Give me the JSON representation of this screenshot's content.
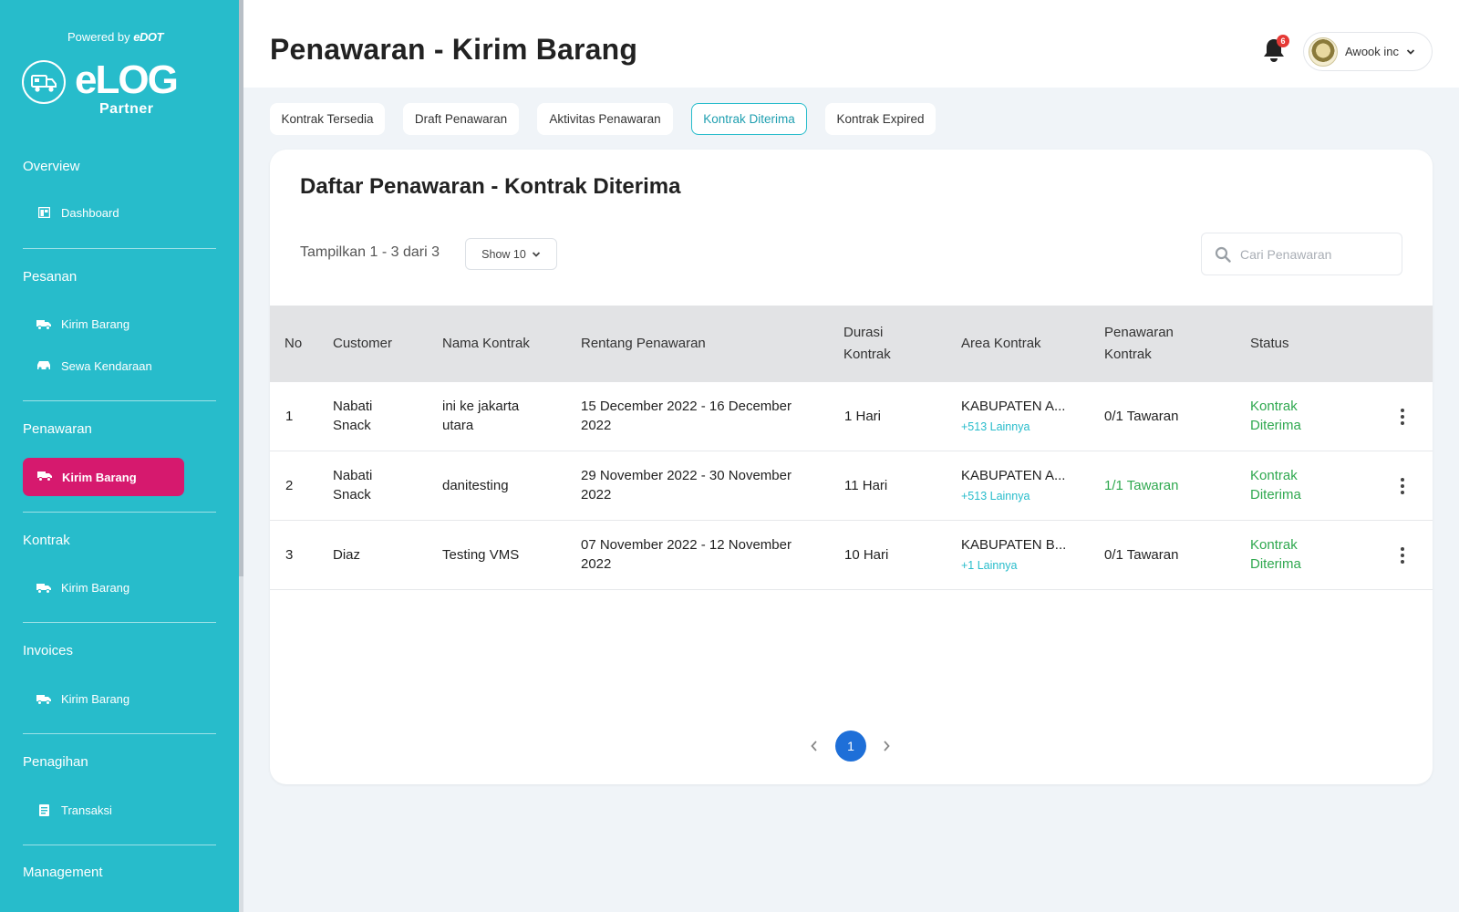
{
  "brand": {
    "powered_by": "Powered by",
    "powered_brand": "eDOT",
    "logo": "eLOG",
    "logo_sub": "Partner",
    "accent": "#27bccb",
    "active_color": "#d6196e"
  },
  "sidebar": {
    "sections": [
      {
        "title": "Overview",
        "items": [
          {
            "label": "Dashboard",
            "icon": "dashboard-icon"
          }
        ]
      },
      {
        "title": "Pesanan",
        "items": [
          {
            "label": "Kirim Barang",
            "icon": "truck-icon"
          },
          {
            "label": "Sewa Kendaraan",
            "icon": "car-rental-icon"
          }
        ]
      },
      {
        "title": "Penawaran",
        "items": [
          {
            "label": "Kirim Barang",
            "icon": "truck-icon",
            "active": true
          }
        ]
      },
      {
        "title": "Kontrak",
        "items": [
          {
            "label": "Kirim Barang",
            "icon": "truck-icon"
          }
        ]
      },
      {
        "title": "Invoices",
        "items": [
          {
            "label": "Kirim Barang",
            "icon": "truck-icon"
          }
        ]
      },
      {
        "title": "Penagihan",
        "items": [
          {
            "label": "Transaksi",
            "icon": "receipt-icon"
          }
        ]
      },
      {
        "title": "Management",
        "items": []
      }
    ]
  },
  "header": {
    "title": "Penawaran - Kirim Barang",
    "notification_count": "6",
    "user_name": "Awook inc"
  },
  "tabs": [
    {
      "label": "Kontrak Tersedia",
      "active": false
    },
    {
      "label": "Draft Penawaran",
      "active": false
    },
    {
      "label": "Aktivitas Penawaran",
      "active": false
    },
    {
      "label": "Kontrak Diterima",
      "active": true
    },
    {
      "label": "Kontrak Expired",
      "active": false
    }
  ],
  "card": {
    "title": "Daftar Penawaran - Kontrak Diterima",
    "showing": "Tampilkan 1 - 3 dari 3",
    "show_select": "Show 10",
    "search_placeholder": "Cari Penawaran"
  },
  "table": {
    "headers": {
      "no": "No",
      "customer": "Customer",
      "nama_kontrak": "Nama Kontrak",
      "rentang": "Rentang Penawaran",
      "durasi_1": "Durasi",
      "durasi_2": "Kontrak",
      "area": "Area Kontrak",
      "penawaran_1": "Penawaran",
      "penawaran_2": "Kontrak",
      "status": "Status"
    },
    "rows": [
      {
        "no": "1",
        "customer_1": "Nabati",
        "customer_2": "Snack",
        "nama_1": "ini ke jakarta",
        "nama_2": "utara",
        "rentang_1": "15 December 2022 - 16 December",
        "rentang_2": "2022",
        "durasi": "1 Hari",
        "area": "KABUPATEN A...",
        "area_more": "+513 Lainnya",
        "penawaran": "0/1 Tawaran",
        "penawaran_green": false,
        "status_1": "Kontrak",
        "status_2": "Diterima"
      },
      {
        "no": "2",
        "customer_1": "Nabati",
        "customer_2": "Snack",
        "nama_1": "danitesting",
        "nama_2": "",
        "rentang_1": "29 November 2022 - 30 November",
        "rentang_2": "2022",
        "durasi": "11 Hari",
        "area": "KABUPATEN A...",
        "area_more": "+513 Lainnya",
        "penawaran": "1/1 Tawaran",
        "penawaran_green": true,
        "status_1": "Kontrak",
        "status_2": "Diterima"
      },
      {
        "no": "3",
        "customer_1": "Diaz",
        "customer_2": "",
        "nama_1": "Testing VMS",
        "nama_2": "",
        "rentang_1": "07 November 2022 - 12 November",
        "rentang_2": "2022",
        "durasi": "10 Hari",
        "area": "KABUPATEN B...",
        "area_more": "+1 Lainnya",
        "penawaran": "0/1 Tawaran",
        "penawaran_green": false,
        "status_1": "Kontrak",
        "status_2": "Diterima"
      }
    ]
  },
  "pagination": {
    "current_page": "1"
  }
}
